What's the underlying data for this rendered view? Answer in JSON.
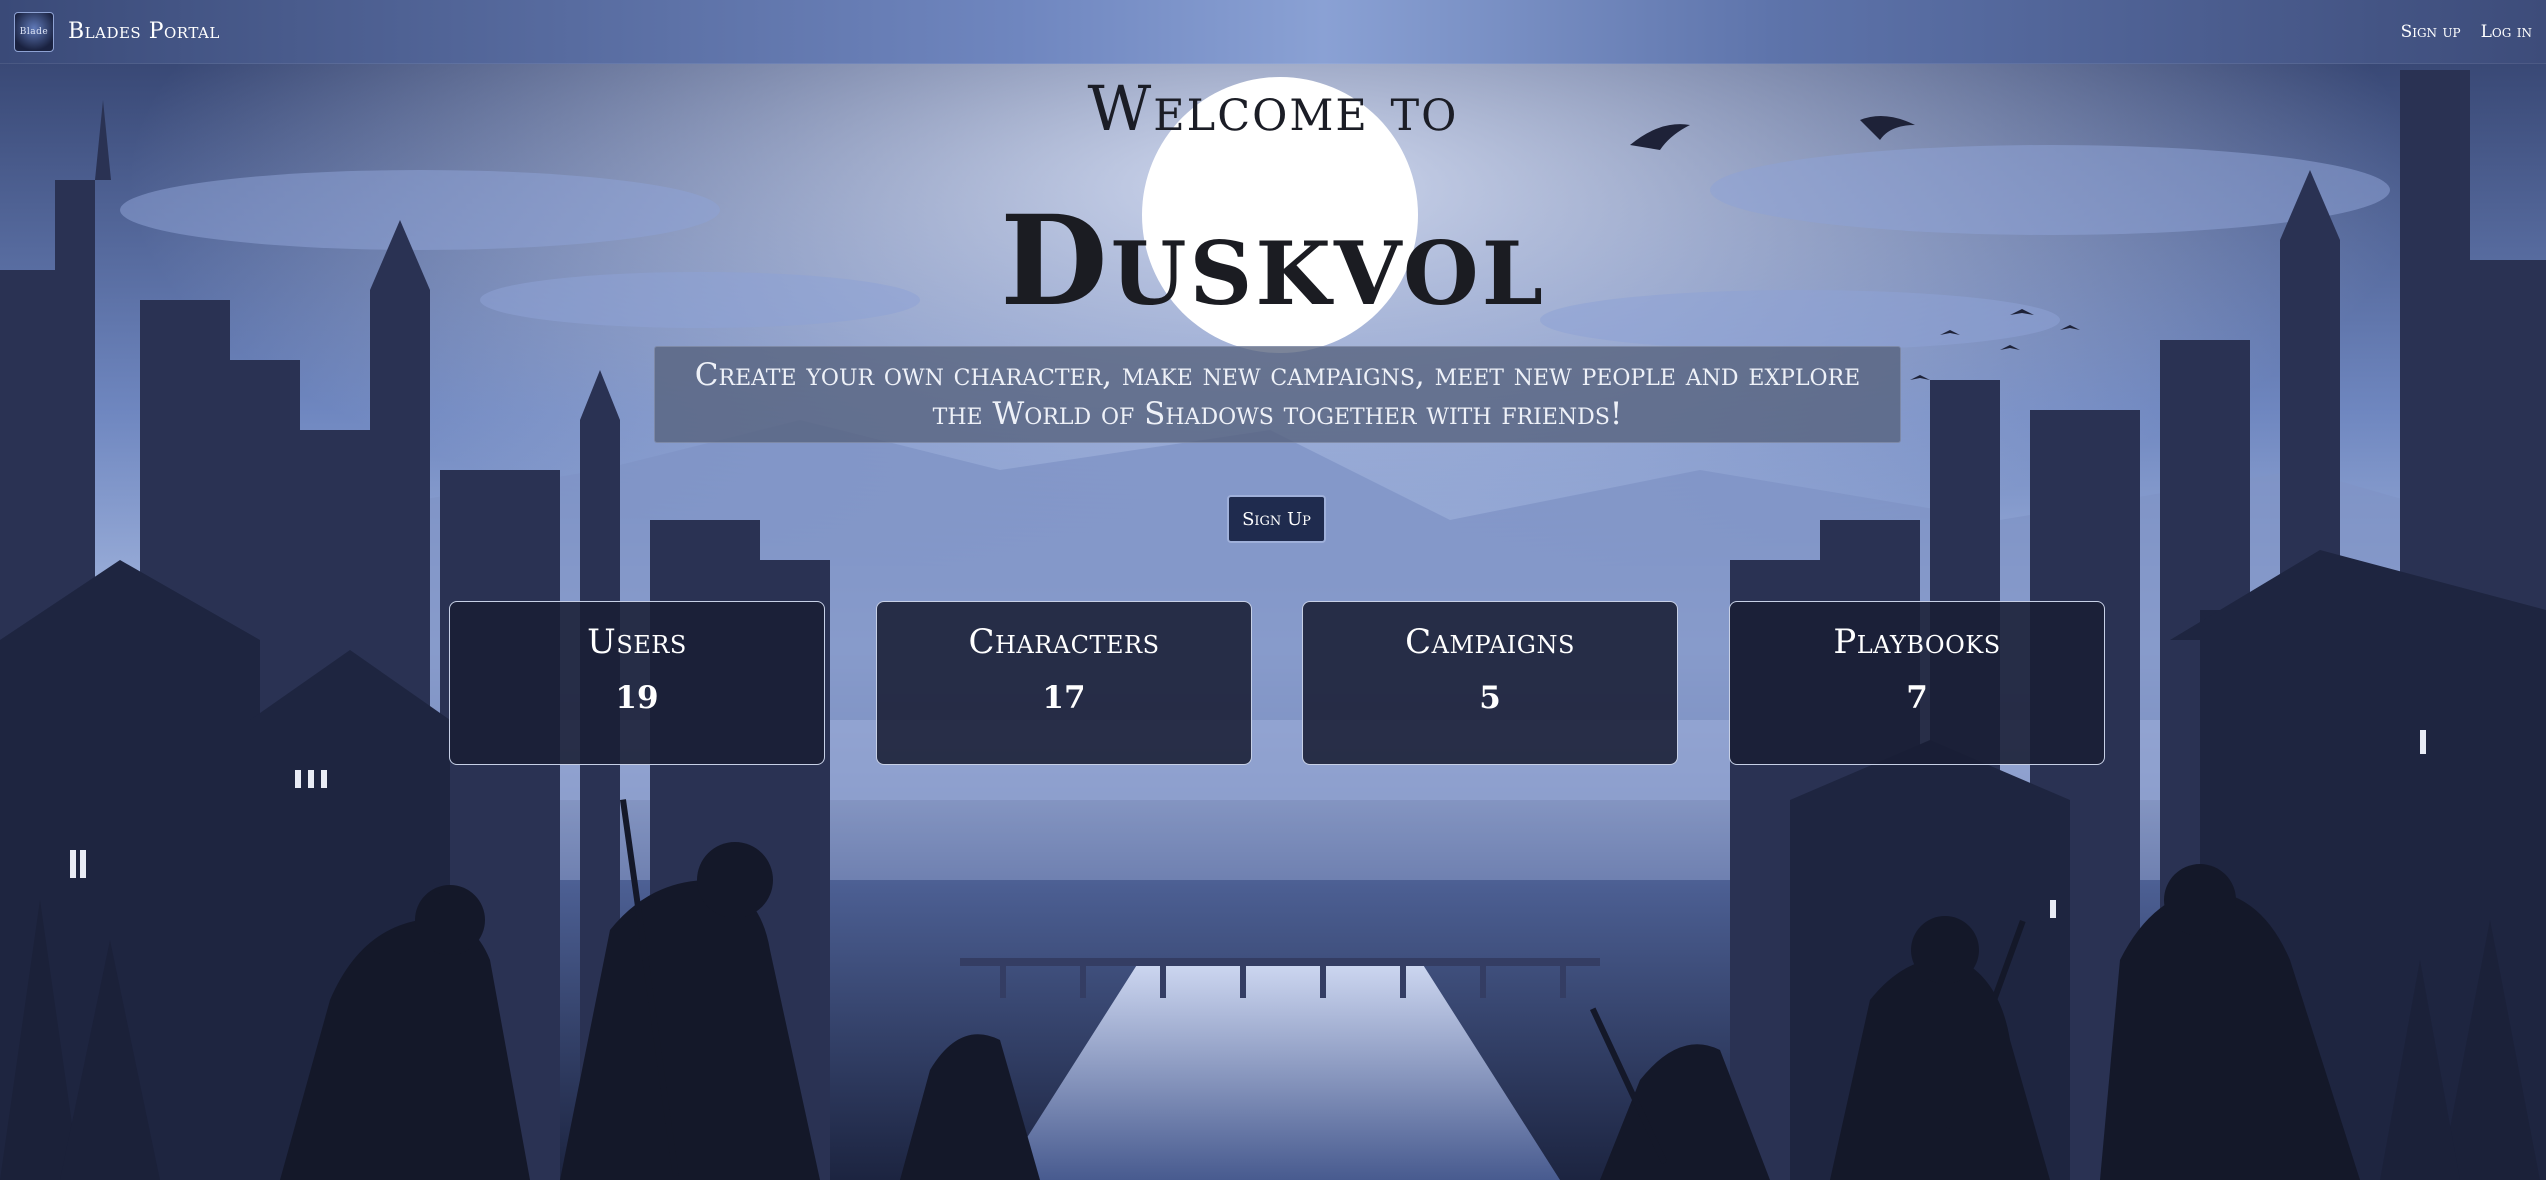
{
  "navbar": {
    "brand_name": "Blades Portal",
    "logo_text": "Blade",
    "signup_label": "Sign up",
    "login_label": "Log in"
  },
  "hero": {
    "welcome": "Welcome to",
    "title": "Duskvol",
    "tagline": "Create your own character, make new campaigns, meet new people and explore the World of Shadows together with friends!",
    "cta_label": "Sign Up"
  },
  "stats": [
    {
      "label": "Users",
      "value": "19"
    },
    {
      "label": "Characters",
      "value": "17"
    },
    {
      "label": "Campaigns",
      "value": "5"
    },
    {
      "label": "Playbooks",
      "value": "7"
    }
  ],
  "colors": {
    "sky": "#7f97cf",
    "moon": "#ffffff",
    "card_bg": "#191e34",
    "button_bg": "#1f2b4e"
  }
}
